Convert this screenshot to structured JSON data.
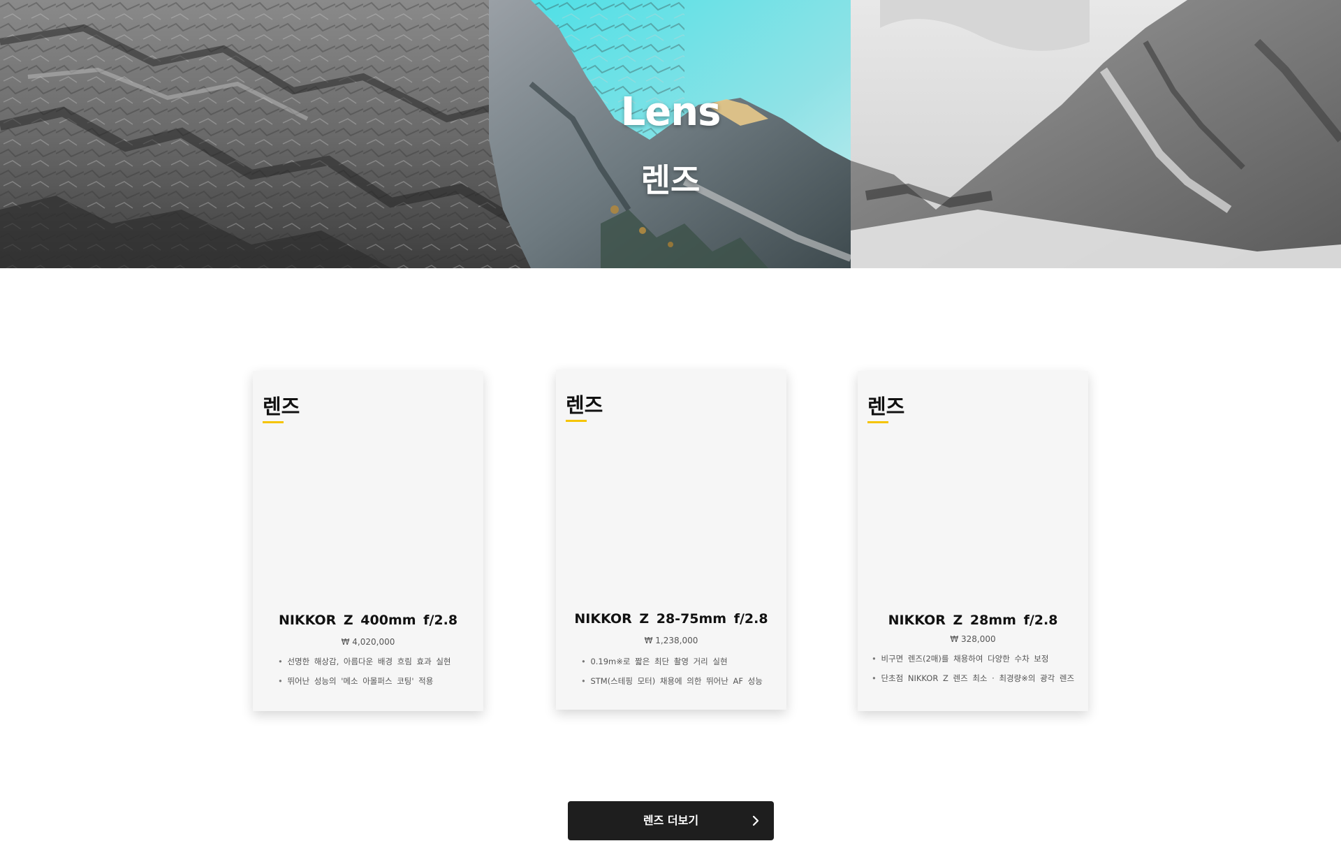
{
  "hero": {
    "title_en": "Lens",
    "title_ko": "렌즈"
  },
  "products": [
    {
      "label": "렌즈",
      "name": "NIKKOR  Z  400mm  f/2.8",
      "price": "₩ 4,020,000",
      "features": [
        "선명한 해상감, 아름다운 배경 흐림 효과 실현",
        "뛰어난 성능의 '메소 아몰퍼스 코팅' 적용"
      ]
    },
    {
      "label": "렌즈",
      "name": "NIKKOR  Z  28-75mm  f/2.8",
      "price": "₩ 1,238,000",
      "features": [
        "0.19m※로 짧은 최단 촬영 거리 실현",
        "STM(스테핑 모터) 채용에 의한 뛰어난 AF 성능"
      ]
    },
    {
      "label": "렌즈",
      "name": "NIKKOR  Z  28mm  f/2.8",
      "price": "₩ 328,000",
      "features": [
        "비구면 렌즈(2매)를 채용하여 다양한 수차 보정",
        "단초점 NIKKOR Z 렌즈 최소 · 최경량※의 광각 렌즈"
      ]
    }
  ],
  "more_button": {
    "label": "렌즈 더보기",
    "icon": "chevron-right-icon"
  },
  "colors": {
    "accent_underline": "#f5c400",
    "button_bg": "#1e1e1e",
    "card_bg": "#f6f6f6",
    "sky": "#5fd8e0"
  }
}
